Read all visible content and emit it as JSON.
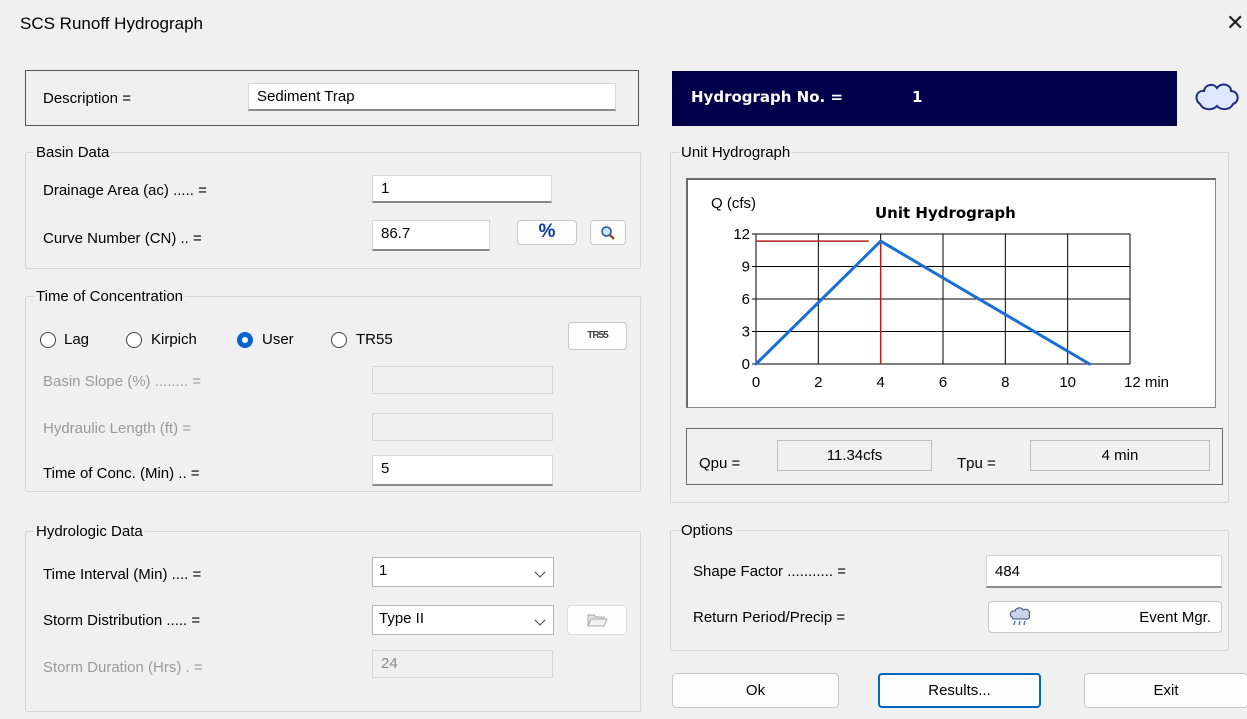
{
  "window": {
    "title": "SCS Runoff Hydrograph",
    "close_glyph": "✕"
  },
  "description": {
    "label": "Description =",
    "value": "Sediment Trap"
  },
  "hydrograph_header": {
    "label": "Hydrograph No. =",
    "number": "1"
  },
  "basin": {
    "legend": "Basin Data",
    "area_label": "Drainage Area (ac) ..... =",
    "area_value": "1",
    "cn_label": "Curve Number (CN) .. =",
    "cn_value": "86.7",
    "percent_button": "%"
  },
  "toc": {
    "legend": "Time of Concentration",
    "methods": [
      {
        "label": "Lag",
        "selected": false
      },
      {
        "label": "Kirpich",
        "selected": false
      },
      {
        "label": "User",
        "selected": true
      },
      {
        "label": "TR55",
        "selected": false
      }
    ],
    "tr55_button": "TR55",
    "slope_label": "Basin Slope (%) ........ =",
    "slope_value": "",
    "length_label": "Hydraulic Length (ft) =",
    "length_value": "",
    "tc_label": "Time of Conc. (Min) .. =",
    "tc_value": "5"
  },
  "hydro": {
    "legend": "Hydrologic Data",
    "interval_label": "Time Interval (Min) .... =",
    "interval_value": "1",
    "storm_label": "Storm Distribution ..... =",
    "storm_value": "Type II",
    "duration_label": "Storm Duration (Hrs) . =",
    "duration_value": "24"
  },
  "unit_hydrograph": {
    "legend": "Unit Hydrograph",
    "qpu_label": "Qpu =",
    "qpu_value": "11.34cfs",
    "tpu_label": "Tpu =",
    "tpu_value": "4 min"
  },
  "options": {
    "legend": "Options",
    "shape_label": "Shape Factor ........... =",
    "shape_value": "484",
    "return_label": "Return Period/Precip  =",
    "event_button": "Event Mgr."
  },
  "buttons": {
    "ok": "Ok",
    "results": "Results...",
    "exit": "Exit"
  },
  "colors": {
    "header_bg": "#00004a",
    "line": "#1a6fd6",
    "marker": "#b22222",
    "radio_on": "#0b62c8"
  },
  "chart_data": {
    "type": "line",
    "title": "Unit Hydrograph",
    "ylabel": "Q (cfs)",
    "xlabel_unit": "min",
    "xlim": [
      0,
      12
    ],
    "ylim": [
      0,
      12
    ],
    "x_ticks": [
      0,
      2,
      4,
      6,
      8,
      10,
      12
    ],
    "x_tick_labels": [
      "0",
      "2",
      "4",
      "6",
      "8",
      "10",
      "12 min"
    ],
    "y_ticks": [
      0,
      3,
      6,
      9,
      12
    ],
    "grid": true,
    "series": [
      {
        "x": [
          0,
          4,
          10.7
        ],
        "y": [
          0,
          11.34,
          0
        ]
      }
    ],
    "peak": {
      "x": 4,
      "y": 11.34
    }
  }
}
